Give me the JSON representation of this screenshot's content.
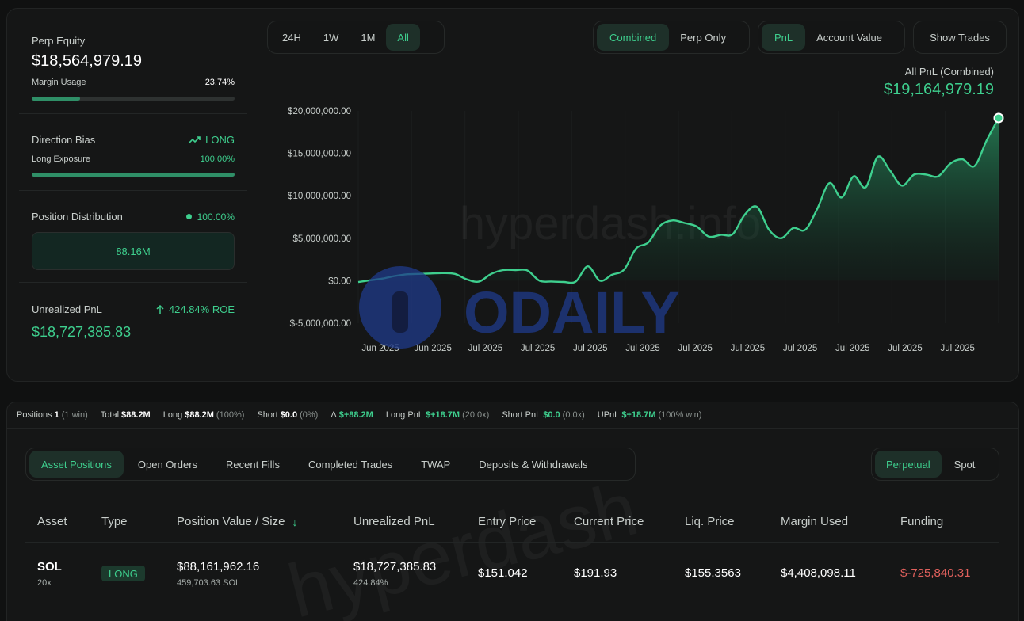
{
  "equity": {
    "label": "Perp Equity",
    "value": "$18,564,979.19",
    "margin_label": "Margin Usage",
    "margin_value": "23.74%",
    "margin_fraction": 0.2374
  },
  "direction": {
    "label": "Direction Bias",
    "bias": "LONG",
    "exposure_label": "Long Exposure",
    "exposure_value": "100.00%",
    "exposure_fraction": 1.0
  },
  "distribution": {
    "label": "Position Distribution",
    "value": "100.00%",
    "box_value": "88.16M"
  },
  "unrealized": {
    "label": "Unrealized PnL",
    "roe": "424.84% ROE",
    "value": "$18,727,385.83"
  },
  "time_tabs": [
    {
      "label": "24H",
      "active": false
    },
    {
      "label": "1W",
      "active": false
    },
    {
      "label": "1M",
      "active": false
    },
    {
      "label": "All",
      "active": true
    }
  ],
  "mode_tabs": [
    {
      "label": "Combined",
      "active": true
    },
    {
      "label": "Perp Only",
      "active": false
    }
  ],
  "metric_tabs": [
    {
      "label": "PnL",
      "active": true
    },
    {
      "label": "Account Value",
      "active": false
    }
  ],
  "show_trades_label": "Show Trades",
  "chart_header": {
    "title": "All PnL (Combined)",
    "value": "$19,164,979.19"
  },
  "watermarks": {
    "site": "hyperdash.info",
    "brand": "ODAILY",
    "table": "hyperdash"
  },
  "colors": {
    "accent": "#3ecf8e",
    "negative": "#e0605c",
    "background": "#101111"
  },
  "chart_data": {
    "type": "area",
    "title": "",
    "xlabel": "",
    "ylabel": "",
    "ylim": [
      -5000000,
      20000000
    ],
    "yticks": [
      20000000,
      15000000,
      10000000,
      5000000,
      0,
      -5000000
    ],
    "ytick_labels": [
      "$20,000,000.00",
      "$15,000,000.00",
      "$10,000,000.00",
      "$5,000,000.00",
      "$0.00",
      "$-5,000,000.00"
    ],
    "xtick_labels": [
      "Jun 2025",
      "Jun 2025",
      "Jul 2025",
      "Jul 2025",
      "Jul 2025",
      "Jul 2025",
      "Jul 2025",
      "Jul 2025",
      "Jul 2025",
      "Jul 2025",
      "Jul 2025",
      "Jul 2025"
    ],
    "grid": true,
    "series": [
      {
        "values": [
          -150000,
          50000,
          250000,
          550000,
          750000,
          800000,
          850000,
          900000,
          800000,
          150000,
          -100000,
          800000,
          1250000,
          1250000,
          1200000,
          0,
          -100000,
          -150000,
          -100000,
          1700000,
          0,
          700000,
          1300000,
          3800000,
          4500000,
          6500000,
          7100000,
          6800000,
          6400000,
          5200000,
          5400000,
          5500000,
          7800000,
          8700000,
          6000000,
          5000000,
          6200000,
          6000000,
          8500000,
          11500000,
          9800000,
          12300000,
          11000000,
          14600000,
          13000000,
          11200000,
          12500000,
          12500000,
          12300000,
          13800000,
          14300000,
          13500000,
          16500000,
          19164979
        ]
      }
    ]
  },
  "summary": {
    "positions_label": "Positions",
    "positions_value": "1",
    "positions_note": "(1 win)",
    "total_label": "Total",
    "total_value": "$88.2M",
    "long_label": "Long",
    "long_value": "$88.2M",
    "long_note": "(100%)",
    "short_label": "Short",
    "short_value": "$0.0",
    "short_note": "(0%)",
    "delta_label": "Δ",
    "delta_value": "$+88.2M",
    "long_pnl_label": "Long PnL",
    "long_pnl_value": "$+18.7M",
    "long_pnl_note": "(20.0x)",
    "short_pnl_label": "Short PnL",
    "short_pnl_value": "$0.0",
    "short_pnl_note": "(0.0x)",
    "upnl_label": "UPnL",
    "upnl_value": "$+18.7M",
    "upnl_note": "(100% win)"
  },
  "table_tabs": [
    {
      "label": "Asset Positions",
      "active": true
    },
    {
      "label": "Open Orders",
      "active": false
    },
    {
      "label": "Recent Fills",
      "active": false
    },
    {
      "label": "Completed Trades",
      "active": false
    },
    {
      "label": "TWAP",
      "active": false
    },
    {
      "label": "Deposits & Withdrawals",
      "active": false
    }
  ],
  "market_tabs": [
    {
      "label": "Perpetual",
      "active": true
    },
    {
      "label": "Spot",
      "active": false
    }
  ],
  "table": {
    "headers": {
      "asset": "Asset",
      "type": "Type",
      "value": "Position Value / Size",
      "upnl": "Unrealized PnL",
      "entry": "Entry Price",
      "current": "Current Price",
      "liq": "Liq. Price",
      "margin": "Margin Used",
      "funding": "Funding"
    },
    "sort_arrow": "↓",
    "rows": [
      {
        "asset": "SOL",
        "leverage": "20x",
        "type": "LONG",
        "value": "$88,161,962.16",
        "size": "459,703.63 SOL",
        "upnl": "$18,727,385.83",
        "upnl_pct": "424.84%",
        "entry": "$151.042",
        "current": "$191.93",
        "liq": "$155.3563",
        "margin": "$4,408,098.11",
        "funding": "$-725,840.31"
      }
    ]
  }
}
